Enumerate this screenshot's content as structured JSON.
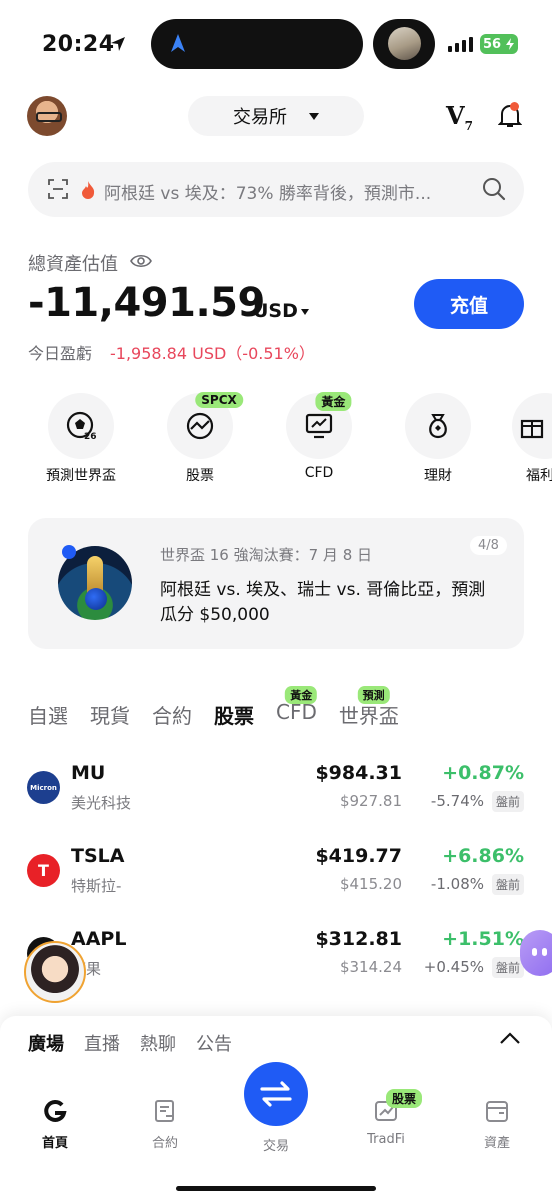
{
  "status_bar": {
    "time": "20:24",
    "battery": "56"
  },
  "header": {
    "exchange_label": "交易所",
    "vip_label": "V",
    "vip_level": "7"
  },
  "search": {
    "text": "阿根廷 vs 埃及：73% 勝率背後，預測市..."
  },
  "assets": {
    "label": "總資產估值",
    "value": "-11,491.59",
    "currency": "USD",
    "deposit_label": "充值",
    "pnl_label": "今日盈虧",
    "pnl_value": "-1,958.84 USD（-0.51%）"
  },
  "quick_actions": [
    {
      "label": "預測世界盃",
      "icon": "soccer-icon",
      "badge": ""
    },
    {
      "label": "股票",
      "icon": "globe-chart-icon",
      "badge": "SPCX"
    },
    {
      "label": "CFD",
      "icon": "monitor-chart-icon",
      "badge": "黃金"
    },
    {
      "label": "理財",
      "icon": "money-bag-icon",
      "badge": ""
    },
    {
      "label": "福利",
      "icon": "gift-icon",
      "badge": ""
    }
  ],
  "banner": {
    "subtitle": "世界盃 16 強淘汰賽：7 月 8 日",
    "title": "阿根廷 vs. 埃及、瑞士 vs. 哥倫比亞，預測瓜分 $50,000",
    "page": "4/8"
  },
  "market_tabs": [
    {
      "label": "自選",
      "badge": ""
    },
    {
      "label": "現貨",
      "badge": ""
    },
    {
      "label": "合約",
      "badge": ""
    },
    {
      "label": "股票",
      "badge": "",
      "active": true
    },
    {
      "label": "CFD",
      "badge": "黃金"
    },
    {
      "label": "世界盃",
      "badge": "預測"
    }
  ],
  "rows": [
    {
      "symbol": "MU",
      "name": "美光科技",
      "price": "$984.31",
      "prev": "$927.81",
      "change": "+0.87%",
      "premarket": "-5.74%",
      "premarket_label": "盤前",
      "logo_text": "Micron",
      "logo_color": "#1d3f8f"
    },
    {
      "symbol": "TSLA",
      "name": "特斯拉-",
      "price": "$419.77",
      "prev": "$415.20",
      "change": "+6.86%",
      "premarket": "-1.08%",
      "premarket_label": "盤前",
      "logo_text": "T",
      "logo_color": "#e82127"
    },
    {
      "symbol": "AAPL",
      "name": "蘋果",
      "price": "$312.81",
      "prev": "$314.24",
      "change": "+1.51%",
      "premarket": "+0.45%",
      "premarket_label": "盤前",
      "logo_text": "",
      "logo_color": "#111111"
    }
  ],
  "social_tabs": [
    "廣場",
    "直播",
    "熱聊",
    "公告"
  ],
  "bottom_nav": {
    "home": "首頁",
    "futures": "合約",
    "trade": "交易",
    "tradfi": "TradFi",
    "tradfi_badge": "股票",
    "assets": "資產"
  },
  "colors": {
    "accent": "#1f5bf5",
    "positive": "#3cbf6a",
    "negative": "#e8475c",
    "badge": "#9ae879"
  }
}
